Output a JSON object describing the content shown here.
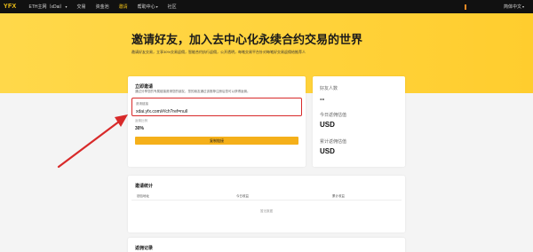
{
  "nav": {
    "logo": "YFX",
    "items": [
      {
        "label": "ETH主网（xDai）",
        "caret": "▾",
        "active": false
      },
      {
        "label": "交易",
        "active": false
      },
      {
        "label": "资金池",
        "active": false
      },
      {
        "label": "邀请",
        "active": true
      },
      {
        "label": "帮助中心",
        "caret": "▾",
        "active": false
      },
      {
        "label": "社区",
        "active": false
      }
    ],
    "language": "简体中文",
    "language_caret": "▾"
  },
  "hero": {
    "title": "邀请好友，加入去中心化永续合约交易的世界",
    "subtitle": "邀请好友交易，立享30%交易返佣，智能合约执行返佣，公开透明，每笔交易平台针对每笔好交易返佣给推荐人"
  },
  "invite": {
    "title": "立即邀请",
    "desc": "通过分享您的专属链接邀请您的朋友，您的朋友通过该推荐注册后您可以获得返佣。",
    "link_label": "邀请链接",
    "link_value": "xdai.yfx.com/#/ch?ref=null",
    "rate_label": "返佣比例",
    "rate_value": "30%",
    "copy_button": "复制链接"
  },
  "stats": {
    "friends_label": "好友人数",
    "friends_value": "--",
    "today_label": "今日返佣估值",
    "today_value": "USD",
    "total_label": "累计返佣估值",
    "total_value": "USD"
  },
  "table": {
    "title": "邀请统计",
    "columns": [
      "钱包地址",
      "今日收益",
      "累计收益"
    ],
    "empty": "暂无数据"
  },
  "bottom": {
    "title": "返佣记录"
  },
  "colors": {
    "accent": "#f5c518",
    "button": "#f5b01a",
    "highlight": "#d82a2a"
  }
}
